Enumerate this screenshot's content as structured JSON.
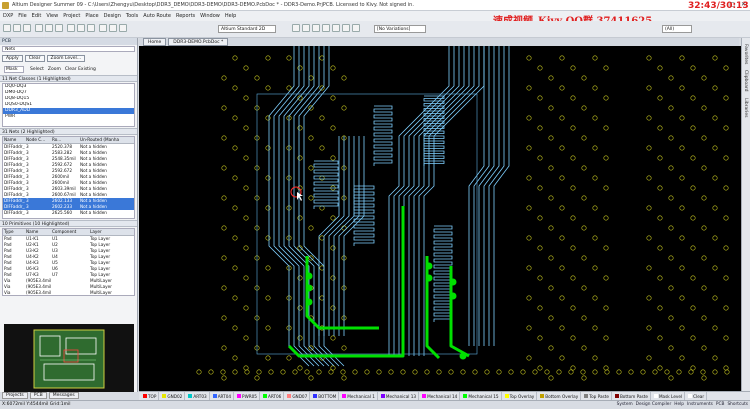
{
  "window": {
    "title": "Altium Designer Summer 09 - C:\\Users\\Zhengyu\\Desktop\\DDR3_DEMO\\DDR3-DEMO\\DDR3-DEMO.PcbDoc * - DDR3-Demo.PrjPCB. Licensed to Kivy. Not signed in.",
    "controls": [
      "–",
      "□",
      "✕"
    ]
  },
  "overlay": {
    "watermark": "速成视频_Kivy QQ群 37411625",
    "clock": "32:43/30:13"
  },
  "menu": [
    "DXP",
    "File",
    "Edit",
    "View",
    "Project",
    "Place",
    "Design",
    "Tools",
    "Auto Route",
    "Reports",
    "Window",
    "Help"
  ],
  "toolbar": {
    "view_style": "Altium Standard 2D",
    "variations": "[No Variations]",
    "all_label": "(All)"
  },
  "doc_tabs": [
    "Home",
    "DDR3-DEMO.PcbDoc *"
  ],
  "panel": {
    "title": "PCB",
    "filter_value": "Nets",
    "buttons": [
      "Apply",
      "Clear",
      "Zoom Level..."
    ],
    "mode": "Mask",
    "checks": [
      "Select",
      "Zoom",
      "Clear Existing"
    ],
    "net_classes_header": "11 Net Classes (1 Highlighted)",
    "net_classes": [
      "DQ0-DQ3",
      "DM0-DQ7",
      "DQ8-DQ15",
      "DQS0-DQS1",
      "DDR3_ADD",
      "PWR"
    ],
    "nets_header": "31 Nets (2 Highlighted)",
    "nets_columns": [
      "Name",
      "Node C...",
      "Ro...",
      "Un-Routed (Manhattan)"
    ],
    "nets": [
      [
        "DIFFaddr_6",
        "3",
        "2520.378",
        "Not a hidden"
      ],
      [
        "DIFFaddr_5",
        "3",
        "2583.282",
        "Not a hidden"
      ],
      [
        "DIFFaddr_5",
        "3",
        "2548.35mil",
        "Not a hidden"
      ],
      [
        "DIFFaddr_5",
        "3",
        "2592.672",
        "Not a hidden"
      ],
      [
        "DIFFaddr_5",
        "3",
        "2592.672",
        "Not a hidden"
      ],
      [
        "DIFFaddr_5",
        "3",
        "2600mil",
        "Not a hidden"
      ],
      [
        "DIFFaddr_5",
        "3",
        "2600mil",
        "Not a hidden"
      ],
      [
        "DIFFaddr_5",
        "3",
        "2603.39mil",
        "Not a hidden"
      ],
      [
        "DIFFaddr_5",
        "3",
        "2600.67mil",
        "Not a hidden"
      ],
      [
        "DIFFaddr_5",
        "3",
        "2602.133",
        "Not a hidden"
      ],
      [
        "DIFFaddr_5",
        "3",
        "2602.233",
        "Not a hidden"
      ],
      [
        "DIFFaddr_5",
        "3",
        "2625.560",
        "Not a hidden"
      ]
    ],
    "primitives_header": "10 Primitives (10 Highlighted)",
    "prim_columns": [
      "Type",
      "Name",
      "Component",
      "Layer"
    ],
    "primitives": [
      [
        "Pad",
        "U1-K1",
        "U1",
        "Top Layer"
      ],
      [
        "Pad",
        "U2-K1",
        "U2",
        "Top Layer"
      ],
      [
        "Pad",
        "U3-K2",
        "U3",
        "Top Layer"
      ],
      [
        "Pad",
        "U4-K2",
        "U4",
        "Top Layer"
      ],
      [
        "Pad",
        "U4-K3",
        "U5",
        "Top Layer"
      ],
      [
        "Pad",
        "U6-K3",
        "U6",
        "Top Layer"
      ],
      [
        "Pad",
        "U7-K3",
        "U7",
        "Top Layer"
      ],
      [
        "Via",
        "(905E3.4mil,5695.1",
        "",
        "MultiLayer"
      ],
      [
        "Via",
        "(905E3.4mil,2550E1",
        "",
        "MultiLayer"
      ],
      [
        "Via",
        "(905E3.4mil,2550E1",
        "",
        "MultiLayer"
      ]
    ]
  },
  "left_tabs": [
    "Projects",
    "PCB",
    "Messages"
  ],
  "right_strip": [
    "Favorites",
    "Clipboard",
    "Libraries"
  ],
  "layers": [
    {
      "name": "TOP",
      "color": "#ff0000"
    },
    {
      "name": "GND02",
      "color": "#e6e600"
    },
    {
      "name": "ART03",
      "color": "#00c8c8"
    },
    {
      "name": "ART04",
      "color": "#3366ff"
    },
    {
      "name": "PWR05",
      "color": "#ff00ff"
    },
    {
      "name": "ART06",
      "color": "#00ff00"
    },
    {
      "name": "GND07",
      "color": "#ff8080"
    },
    {
      "name": "BOTTOM",
      "color": "#3030ff"
    },
    {
      "name": "Mechanical 1",
      "color": "#ff00ff"
    },
    {
      "name": "Mechanical 13",
      "color": "#8000ff"
    },
    {
      "name": "Mechanical 14",
      "color": "#ff00ff"
    },
    {
      "name": "Mechanical 15",
      "color": "#00ff00"
    },
    {
      "name": "Top Overlay",
      "color": "#ffff00"
    },
    {
      "name": "Bottom Overlay",
      "color": "#c0a000"
    },
    {
      "name": "Top Paste",
      "color": "#808080"
    },
    {
      "name": "Bottom Paste",
      "color": "#800000"
    },
    {
      "name": "Mask Level",
      "color": "#ffffff"
    },
    {
      "name": "Clear",
      "color": "#ffffff"
    }
  ],
  "status": {
    "coords": "X:6072mil Y:4544mil   Grid:1mil",
    "right_buttons": [
      "System",
      "Design Compiler",
      "Help",
      "Instruments",
      "PCB",
      "Shortcuts"
    ]
  },
  "colors": {
    "track_blue": "#7fd0ff",
    "track_green": "#00e000",
    "via_yellow": "#c8c820",
    "canvas_bg": "#000000"
  }
}
